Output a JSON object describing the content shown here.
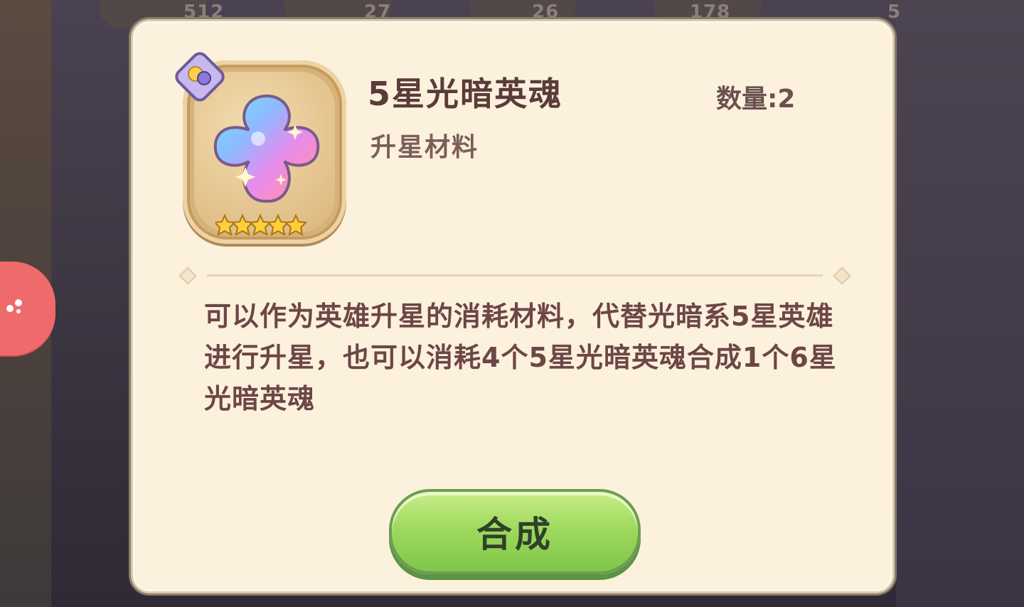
{
  "background": {
    "numbers": [
      "512",
      "27",
      "26",
      "178",
      "5"
    ]
  },
  "item": {
    "name": "5星光暗英魂",
    "quantity": "数量:2",
    "category": "升星材料",
    "star_count": 5,
    "description": "可以作为英雄升星的消耗材料，代替光暗系5星英雄进行升星，也可以消耗4个5星光暗英魂合成1个6星光暗英魂"
  },
  "action": {
    "synthesize_label": "合成"
  },
  "icons": [
    "light-dark-element-badge-icon",
    "rainbow-soul-item-icon",
    "star-rating-icon",
    "side-menu-tab-icon"
  ],
  "colors": {
    "dialog_bg": "#fcf1dc",
    "title": "#5a3b3a",
    "button_green": "#9fda5e",
    "side_tab": "#ef6b6b"
  }
}
